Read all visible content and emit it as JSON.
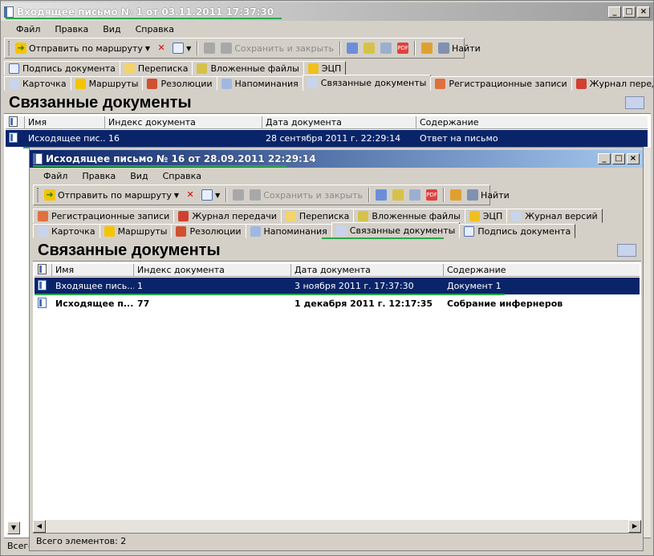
{
  "outer": {
    "title": "Входящее письмо № 1 от 03.11.2011 17:37:30",
    "menu": [
      "Файл",
      "Правка",
      "Вид",
      "Справка"
    ],
    "toolbar": {
      "send": "Отправить по маршруту",
      "save_close": "Сохранить и закрыть",
      "find": "Найти"
    },
    "tabs_row1": [
      "Подпись документа",
      "Переписка",
      "Вложенные файлы",
      "ЭЦП"
    ],
    "tabs_row2": [
      "Карточка",
      "Маршруты",
      "Резолюции",
      "Напоминания",
      "Связанные документы",
      "Регистрационные записи",
      "Журнал передачи"
    ],
    "panel_title": "Связанные документы",
    "columns": [
      "Имя",
      "Индекс документа",
      "Дата документа",
      "Содержание"
    ],
    "rows": [
      {
        "name": "Исходящее пис...",
        "index": "16",
        "date": "28 сентября 2011 г. 22:29:14",
        "content": "Ответ на письмо"
      }
    ],
    "status": "Всего"
  },
  "inner": {
    "title": "Исходящее письмо № 16 от 28.09.2011 22:29:14",
    "menu": [
      "Файл",
      "Правка",
      "Вид",
      "Справка"
    ],
    "toolbar": {
      "send": "Отправить по маршруту",
      "save_close": "Сохранить и закрыть",
      "find": "Найти"
    },
    "tabs_row1": [
      "Регистрационные записи",
      "Журнал передачи",
      "Переписка",
      "Вложенные файлы",
      "ЭЦП",
      "Журнал версий"
    ],
    "tabs_row2": [
      "Карточка",
      "Маршруты",
      "Резолюции",
      "Напоминания",
      "Связанные документы",
      "Подпись документа"
    ],
    "panel_title": "Связанные документы",
    "columns": [
      "Имя",
      "Индекс документа",
      "Дата документа",
      "Содержание"
    ],
    "rows": [
      {
        "name": "Входящее пись...",
        "index": "1",
        "date": "3 ноября 2011 г. 17:37:30",
        "content": "Документ 1"
      },
      {
        "name": "Исходящее п...",
        "index": "77",
        "date": "1 декабря 2011 г. 12:17:35",
        "content": "Собрание инфернеров"
      }
    ],
    "status": "Всего элементов: 2"
  }
}
